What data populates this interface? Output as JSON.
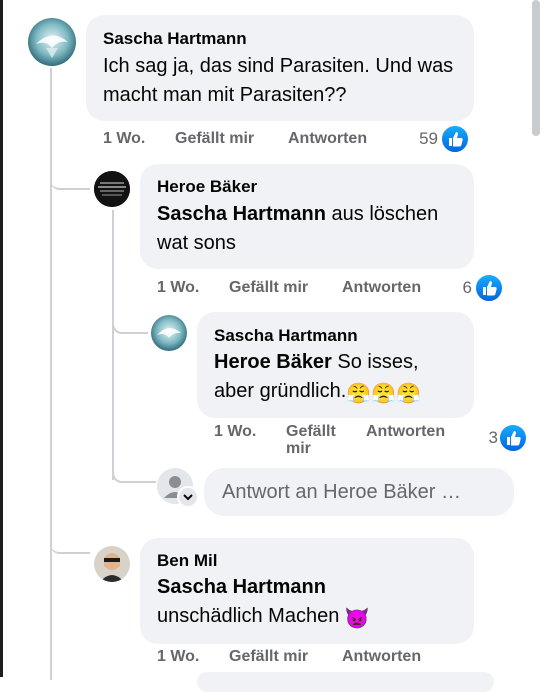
{
  "comments": [
    {
      "author": "Sascha Hartmann",
      "text": "Ich sag ja, das sind Parasiten. Und was macht man mit Parasiten??",
      "time": "1 Wo.",
      "like_label": "Gefällt mir",
      "reply_label": "Antworten",
      "likes": "59"
    },
    {
      "author": "Heroe Bäker",
      "mention": "Sascha Hartmann",
      "text": " aus löschen wat sons",
      "time": "1 Wo.",
      "like_label": "Gefällt mir",
      "reply_label": "Antworten",
      "likes": "6"
    },
    {
      "author": "Sascha Hartmann",
      "mention": "Heroe Bäker",
      "text": " So isses, aber gründlich.",
      "emoji": "😤😤😤",
      "time": "1 Wo.",
      "like_label": "Gefällt mir",
      "reply_label": "Antworten",
      "likes": "3"
    },
    {
      "author": "Ben Mil",
      "mention": "Sascha Hartmann",
      "text": "unschädlich Machen ",
      "emoji": "👿",
      "time": "1 Wo.",
      "like_label": "Gefällt mir",
      "reply_label": "Antworten"
    }
  ],
  "reply_box": {
    "placeholder": "Antwort an Heroe Bäker …"
  },
  "colors": {
    "bubble": "#f0f2f5",
    "meta_text": "#65676b",
    "like_blue": "#0866ff",
    "thread_line": "#ced0d4"
  }
}
